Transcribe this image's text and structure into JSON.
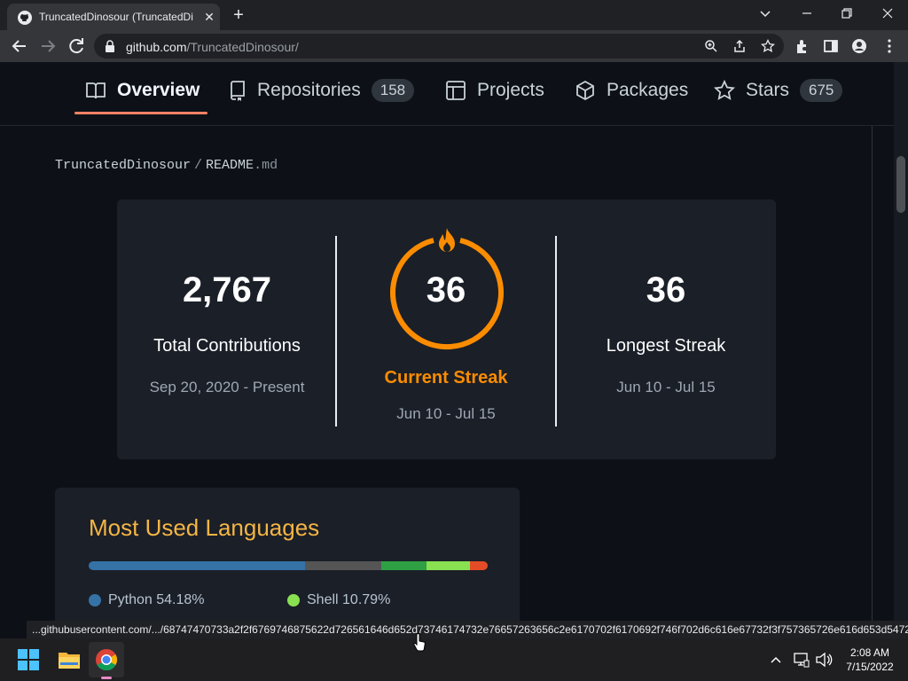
{
  "browser": {
    "tab_title": "TruncatedDinosour (TruncatedDi",
    "url_host": "github.com",
    "url_path": "/TruncatedDinosour/",
    "status_link": "...githubusercontent.com/.../68747470733a2f2f6769746875622d726561646d652d73746174732e76657263656c2e6170702f6170692f746f702d6c616e67732f3f757365726e616d653d5472..."
  },
  "profile_nav": {
    "tabs": [
      {
        "label": "Overview",
        "icon": "book-icon",
        "active": true
      },
      {
        "label": "Repositories",
        "icon": "repo-icon",
        "count": "158"
      },
      {
        "label": "Projects",
        "icon": "table-icon"
      },
      {
        "label": "Packages",
        "icon": "package-icon"
      },
      {
        "label": "Stars",
        "icon": "star-icon",
        "count": "675"
      }
    ]
  },
  "readme": {
    "owner": "TruncatedDinosour",
    "separator": "/",
    "file_name": "README",
    "file_ext": ".md"
  },
  "streak_stats": {
    "total": {
      "value": "2,767",
      "label": "Total Contributions",
      "range": "Sep 20, 2020 - Present"
    },
    "current": {
      "value": "36",
      "label": "Current Streak",
      "range": "Jun 10 - Jul 15"
    },
    "longest": {
      "value": "36",
      "label": "Longest Streak",
      "range": "Jun 10 - Jul 15"
    },
    "colors": {
      "background": "#1b1f28",
      "ring": "#fb8c00",
      "text": "#ffffff",
      "dates": "#9ea7b3"
    }
  },
  "languages": {
    "title": "Most Used Languages",
    "bar_segments": [
      {
        "percent": 54.18,
        "color": "#3572a5"
      },
      {
        "percent": 19.2,
        "color": "#555555"
      },
      {
        "percent": 11.3,
        "color": "#2ea043"
      },
      {
        "percent": 10.79,
        "color": "#89e051"
      },
      {
        "percent": 4.53,
        "color": "#e34c26"
      }
    ],
    "items": [
      {
        "name": "Python 54.18%",
        "color": "#3572a5"
      },
      {
        "name": "Shell 10.79%",
        "color": "#89e051"
      }
    ]
  },
  "taskbar": {
    "time": "2:08 AM",
    "date": "7/15/2022"
  }
}
